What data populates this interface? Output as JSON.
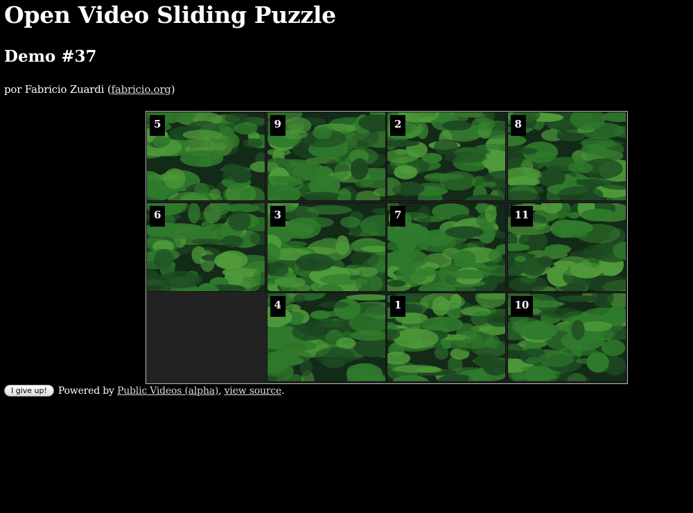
{
  "page": {
    "title": "Open Video Sliding Puzzle",
    "subtitle": "Demo #37",
    "byline_prefix": "por Fabricio Zuardi (",
    "byline_link": "fabricio.org",
    "byline_suffix": ")"
  },
  "puzzle": {
    "rows": 3,
    "cols": 4,
    "empty_cell": {
      "row": 2,
      "col": 0
    },
    "tiles": [
      {
        "label": "5",
        "row": 0,
        "col": 0
      },
      {
        "label": "9",
        "row": 0,
        "col": 1
      },
      {
        "label": "2",
        "row": 0,
        "col": 2
      },
      {
        "label": "8",
        "row": 0,
        "col": 3
      },
      {
        "label": "6",
        "row": 1,
        "col": 0
      },
      {
        "label": "3",
        "row": 1,
        "col": 1
      },
      {
        "label": "7",
        "row": 1,
        "col": 2
      },
      {
        "label": "11",
        "row": 1,
        "col": 3
      },
      {
        "label": "4",
        "row": 2,
        "col": 1
      },
      {
        "label": "1",
        "row": 2,
        "col": 2
      },
      {
        "label": "10",
        "row": 2,
        "col": 3
      }
    ],
    "colors": {
      "leaf_light": "#4f9a3a",
      "leaf_mid": "#2f7a2c",
      "leaf_dark": "#1d4a22",
      "shadow": "#142a18"
    }
  },
  "footer": {
    "button_label": "I give up!",
    "powered_prefix": "Powered by",
    "powered_link": "Public Videos (alpha)",
    "separator": ",",
    "source_link": "view source",
    "end": "."
  }
}
